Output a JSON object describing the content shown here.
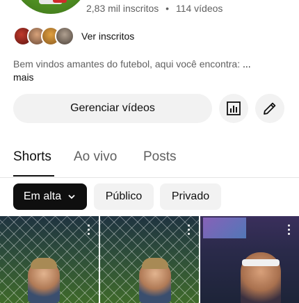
{
  "channel": {
    "subscribers": "2,83 mil inscritos",
    "separator": "•",
    "videos": "114 vídeos",
    "subscribers_link": "Ver inscritos",
    "description": "Bem vindos amantes do futebol, aqui você encontra:",
    "description_ellipsis": "...",
    "more": "mais"
  },
  "actions": {
    "manage_videos": "Gerenciar vídeos",
    "analytics_icon": "bar-chart-icon",
    "edit_icon": "pencil-icon"
  },
  "tabs": [
    {
      "label": "Shorts",
      "active": true
    },
    {
      "label": "Ao vivo",
      "active": false
    },
    {
      "label": "Posts",
      "active": false
    }
  ],
  "filters": [
    {
      "label": "Em alta",
      "selected": true
    },
    {
      "label": "Público",
      "selected": false
    },
    {
      "label": "Privado",
      "selected": false
    }
  ],
  "colors": {
    "text_primary": "#0f0f0f",
    "text_secondary": "#606060",
    "button_bg": "#f2f2f2",
    "chip_selected_bg": "#0f0f0f"
  }
}
